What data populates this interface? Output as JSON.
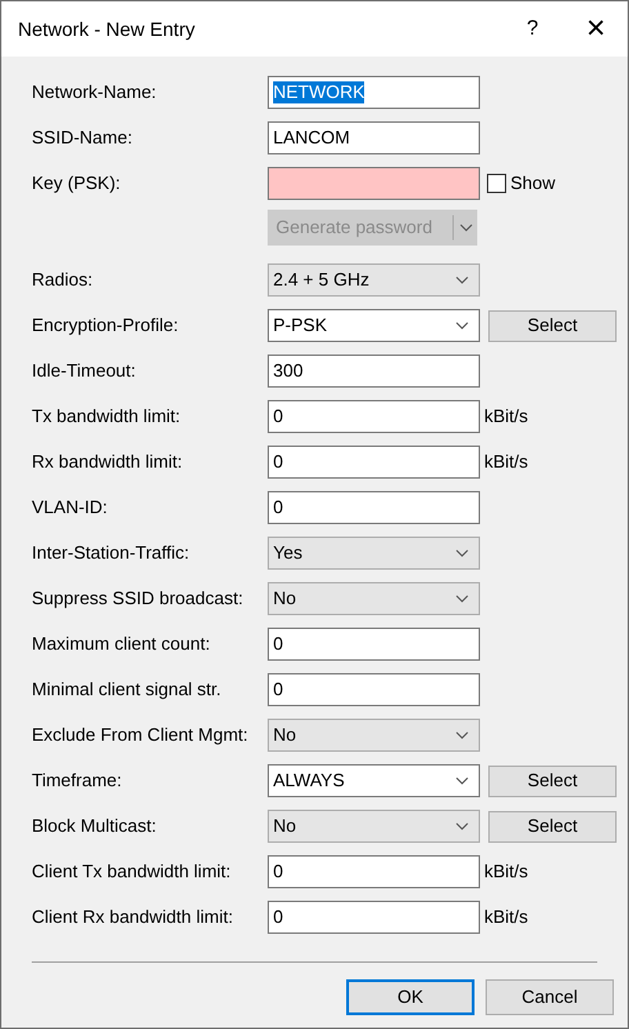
{
  "window": {
    "title": "Network - New Entry",
    "help": "?",
    "close": "×"
  },
  "rows": [
    {
      "kind": "text",
      "label": "Network-Name:",
      "value": "NETWORK",
      "highlighted": true
    },
    {
      "kind": "text",
      "label": "SSID-Name:",
      "value": "LANCOM",
      "highlighted": false
    },
    {
      "kind": "key",
      "label": "Key (PSK):",
      "show": {
        "label": "Show",
        "checked": false
      },
      "generate": {
        "label": "Generate password",
        "disabled": true
      }
    },
    {
      "kind": "list",
      "label": "Radios:",
      "value": "2.4 + 5 GHz"
    },
    {
      "kind": "combo",
      "label": "Encryption-Profile:",
      "value": "P-PSK",
      "button": "Select"
    },
    {
      "kind": "text",
      "label": "Idle-Timeout:",
      "value": "300",
      "highlighted": false
    },
    {
      "kind": "text",
      "label": "Tx bandwidth limit:",
      "value": "0",
      "unit": "kBit/s",
      "highlighted": false
    },
    {
      "kind": "text",
      "label": "Rx bandwidth limit:",
      "value": "0",
      "unit": "kBit/s",
      "highlighted": false
    },
    {
      "kind": "text",
      "label": "VLAN-ID:",
      "value": "0",
      "highlighted": false
    },
    {
      "kind": "list",
      "label": "Inter-Station-Traffic:",
      "value": "Yes"
    },
    {
      "kind": "list",
      "label": "Suppress SSID broadcast:",
      "value": "No"
    },
    {
      "kind": "text",
      "label": "Maximum client count:",
      "value": "0",
      "highlighted": false
    },
    {
      "kind": "text",
      "label": "Minimal client signal str.",
      "value": "0",
      "highlighted": false
    },
    {
      "kind": "list",
      "label": "Exclude From Client Mgmt:",
      "value": "No"
    },
    {
      "kind": "combo",
      "label": "Timeframe:",
      "value": "ALWAYS",
      "button": "Select"
    },
    {
      "kind": "list",
      "label": "Block Multicast:",
      "value": "No",
      "button": "Select"
    },
    {
      "kind": "text",
      "label": "Client Tx bandwidth limit:",
      "value": "0",
      "unit": "kBit/s",
      "highlighted": false
    },
    {
      "kind": "text",
      "label": "Client Rx bandwidth limit:",
      "value": "0",
      "unit": "kBit/s",
      "highlighted": false
    }
  ],
  "buttons": [
    {
      "label": "OK",
      "default": true
    },
    {
      "label": "Cancel",
      "default": false
    }
  ]
}
